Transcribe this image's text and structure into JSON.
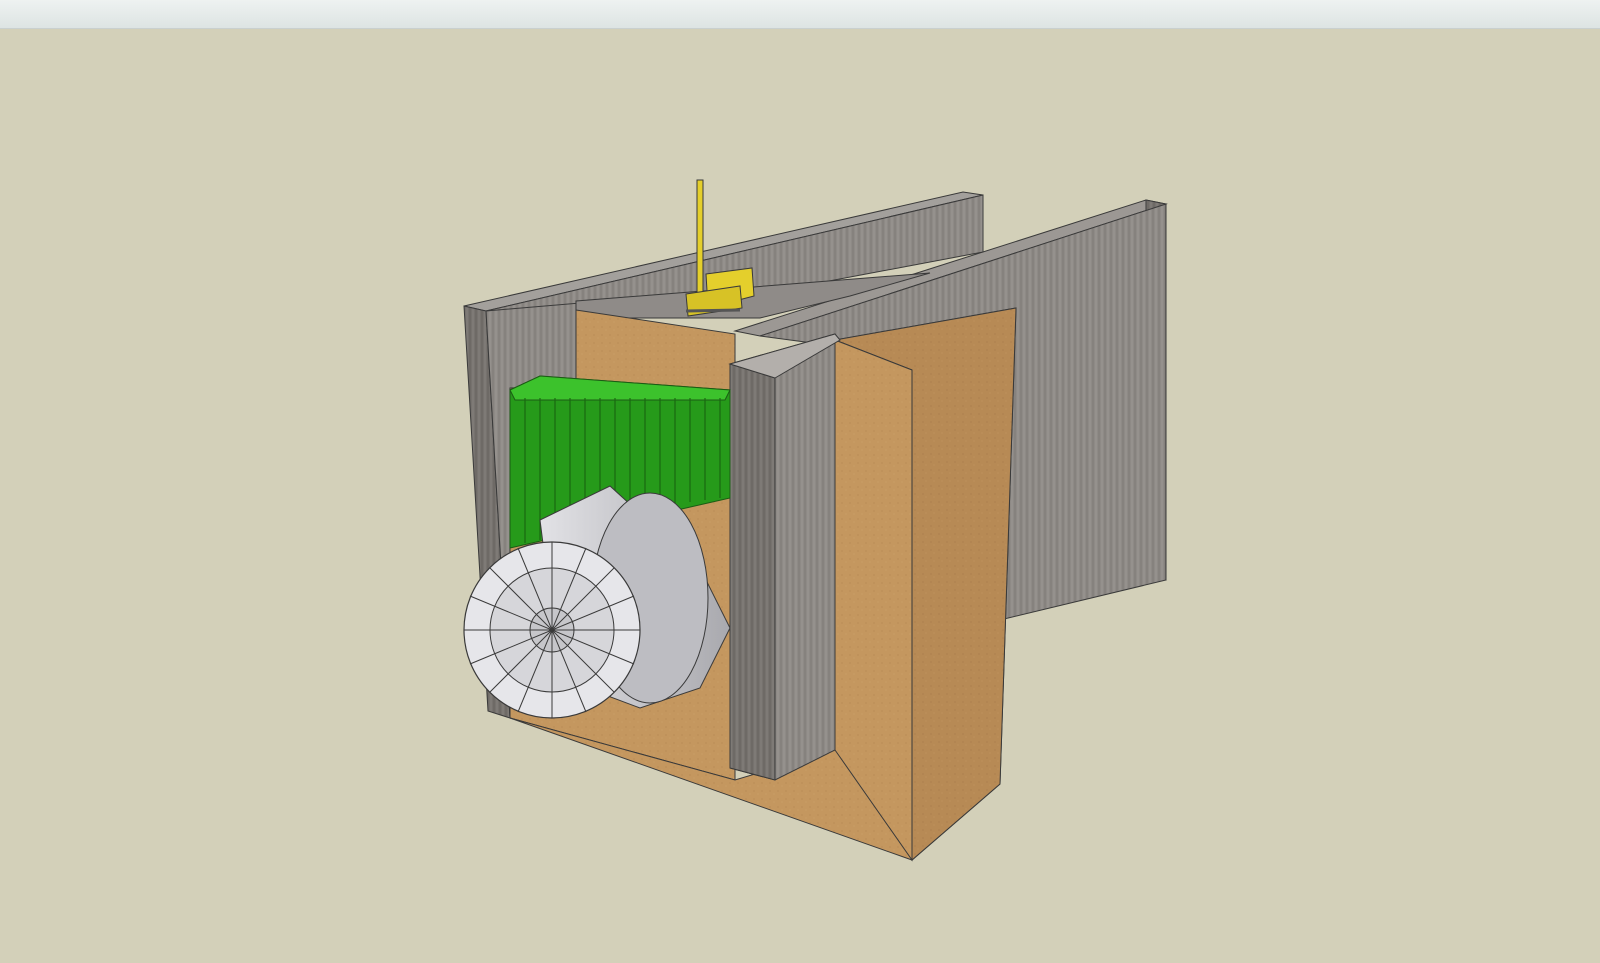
{
  "window": {
    "title": ""
  },
  "viewport": {
    "background_color": "#d3d0b9"
  },
  "model": {
    "description_label": "",
    "colors": {
      "soil": "#c2955f",
      "soil_side": "#b98b55",
      "wall": "#8e8a86",
      "wall_dark": "#6f6b68",
      "columns": "#2fa81f",
      "tbm": "#c8c8cc",
      "rig": "#e4cf2c"
    },
    "components": [
      "soil-block",
      "diaphragm-wall-left",
      "diaphragm-wall-right",
      "jet-grout-columns",
      "tunnel-boring-machine",
      "drill-rig"
    ]
  }
}
